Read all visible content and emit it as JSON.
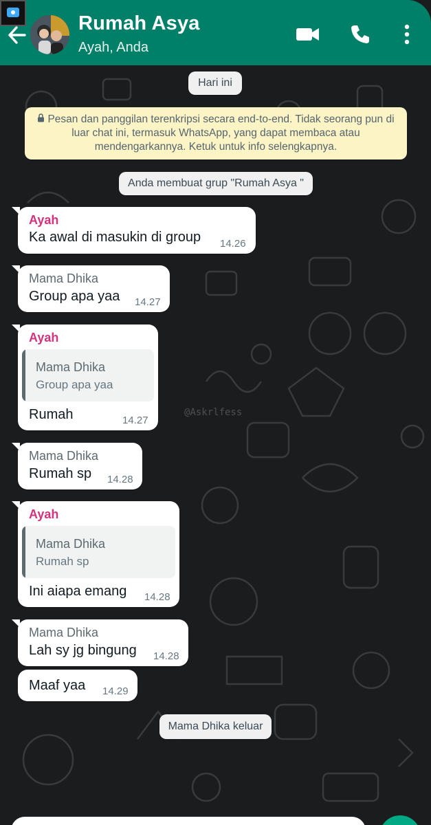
{
  "header": {
    "title": "Rumah Asya",
    "subtitle": "Ayah, Anda",
    "icons": [
      "back-arrow-icon",
      "video-call-icon",
      "voice-call-icon",
      "more-vertical-icon"
    ],
    "color": "#008069"
  },
  "chat": {
    "date_chip": "Hari ini",
    "encryption_notice": "Pesan dan panggilan terenkripsi secara end-to-end. Tidak seorang pun di luar chat ini, termasuk WhatsApp, yang dapat membaca atau mendengarkannya. Ketuk untuk info selengkapnya.",
    "group_created": "Anda membuat grup \"Rumah Asya \"",
    "messages": [
      {
        "sender": "Ayah",
        "text": "Ka awal di masukin di group",
        "time": "14.26"
      },
      {
        "sender": "Mama Dhika",
        "text": "Group apa yaa",
        "time": "14.27"
      },
      {
        "sender": "Ayah",
        "quote": {
          "name": "Mama Dhika",
          "text": "Group apa yaa"
        },
        "text": "Rumah",
        "time": "14.27"
      },
      {
        "sender": "Mama Dhika",
        "text": "Rumah sp",
        "time": "14.28"
      },
      {
        "sender": "Ayah",
        "quote": {
          "name": "Mama Dhika",
          "text": "Rumah sp"
        },
        "text": "Ini aiapa emang",
        "time": "14.28"
      },
      {
        "sender": "Mama Dhika",
        "text": "Lah sy jg bingung",
        "time": "14.28"
      },
      {
        "sender": "",
        "text": "Maaf yaa",
        "time": "14.29"
      }
    ],
    "left_notice": "Mama Dhika keluar",
    "watermark": "@Askrlfess"
  },
  "colors": {
    "ayah_name": "#d5317c",
    "mama_name": "#5d6a70",
    "background": "#1b1c1e",
    "encryption_bg": "#fdf4c5"
  }
}
